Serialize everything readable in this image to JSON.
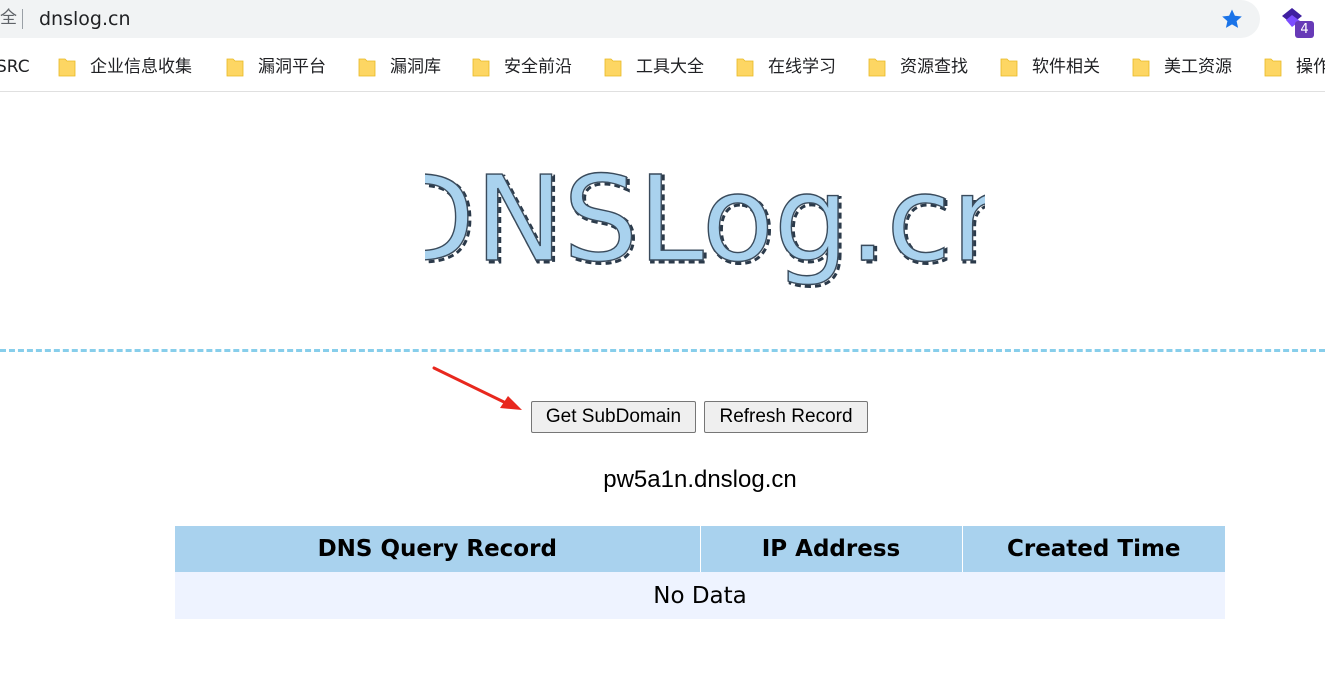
{
  "browser": {
    "security_text": "全",
    "url": "dnslog.cn",
    "extension_badge": "4",
    "colors": {
      "star": "#1a73e8",
      "extension": "#673ab7",
      "folder": "#fdd663"
    }
  },
  "bookmarks": [
    {
      "label": "SRC"
    },
    {
      "label": "企业信息收集"
    },
    {
      "label": "漏洞平台"
    },
    {
      "label": "漏洞库"
    },
    {
      "label": "安全前沿"
    },
    {
      "label": "工具大全"
    },
    {
      "label": "在线学习"
    },
    {
      "label": "资源查找"
    },
    {
      "label": "软件相关"
    },
    {
      "label": "美工资源"
    },
    {
      "label": "操作"
    }
  ],
  "page": {
    "logo_text": "DNSLog.cn",
    "buttons": {
      "get_subdomain": "Get SubDomain",
      "refresh_record": "Refresh Record"
    },
    "subdomain": "pw5a1n.dnslog.cn",
    "table": {
      "headers": [
        "DNS Query Record",
        "IP Address",
        "Created Time"
      ],
      "empty_text": "No Data"
    },
    "colors": {
      "divider": "#87ceeb",
      "table_header": "#a9d2ee",
      "table_row": "#eef3ff",
      "arrow": "#e8281e"
    }
  }
}
